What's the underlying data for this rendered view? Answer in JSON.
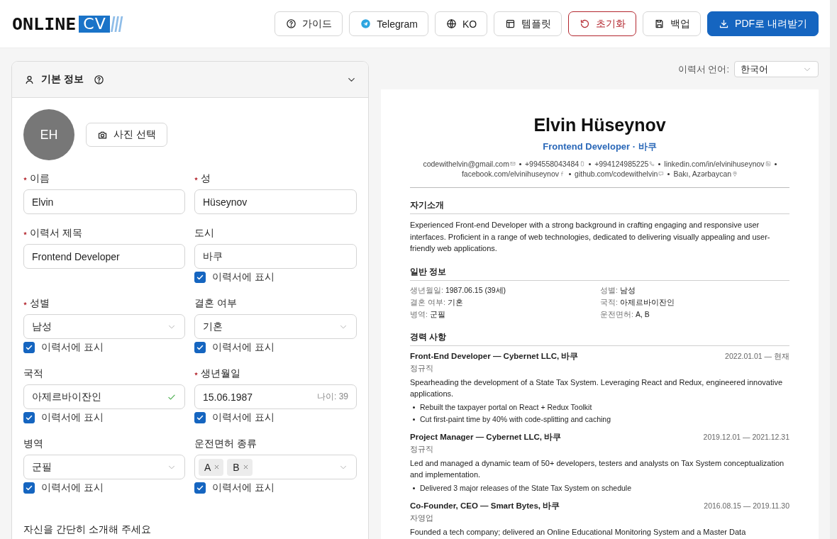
{
  "header": {
    "logo": {
      "text": "ONLINE",
      "highlight": "CV"
    },
    "buttons": [
      {
        "label": "가이드",
        "kind": "default"
      },
      {
        "label": "Telegram",
        "kind": "default"
      },
      {
        "label": "KO",
        "kind": "default"
      },
      {
        "label": "템플릿",
        "kind": "default"
      },
      {
        "label": "초기화",
        "kind": "danger"
      },
      {
        "label": "백업",
        "kind": "default"
      },
      {
        "label": "PDF로 내려받기",
        "kind": "primary"
      }
    ]
  },
  "form": {
    "section": {
      "title": "기본 정보",
      "expanded": true
    },
    "avatar": {
      "initials": "EH"
    },
    "photo_button": "사진 선택",
    "rows": [
      [
        {
          "label": "이름",
          "required": true,
          "kind": "text",
          "value": "Elvin"
        },
        {
          "label": "성",
          "required": true,
          "kind": "text",
          "value": "Hüseynov"
        }
      ],
      [
        {
          "label": "이력서 제목",
          "required": true,
          "kind": "text",
          "value": "Frontend Developer"
        },
        {
          "label": "도시",
          "required": false,
          "kind": "text",
          "value": "바쿠",
          "show_on_resume": {
            "label": "이력서에 표시",
            "checked": true
          }
        }
      ],
      [
        {
          "label": "성별",
          "required": true,
          "kind": "select",
          "value": "남성",
          "show_on_resume": {
            "label": "이력서에 표시",
            "checked": true
          }
        },
        {
          "label": "결혼 여부",
          "required": false,
          "kind": "select",
          "value": "기혼",
          "show_on_resume": {
            "label": "이력서에 표시",
            "checked": true
          }
        }
      ],
      [
        {
          "label": "국적",
          "required": false,
          "kind": "text",
          "value": "아제르바이잔인",
          "valid": true,
          "show_on_resume": {
            "label": "이력서에 표시",
            "checked": true
          }
        },
        {
          "label": "생년월일",
          "required": true,
          "kind": "date",
          "value": "15.06.1987",
          "hint": "나이: 39",
          "show_on_resume": {
            "label": "이력서에 표시",
            "checked": true
          }
        }
      ],
      [
        {
          "label": "병역",
          "required": false,
          "kind": "select",
          "value": "군필",
          "show_on_resume": {
            "label": "이력서에 표시",
            "checked": true
          }
        },
        {
          "label": "운전면허 종류",
          "required": false,
          "kind": "tags",
          "tags": [
            "A",
            "B"
          ],
          "show_on_resume": {
            "label": "이력서에 표시",
            "checked": true
          }
        }
      ]
    ],
    "about_label": "자신을 간단히 소개해 주세요"
  },
  "preview": {
    "language": {
      "label": "이력서 언어:",
      "value": "한국어"
    },
    "resume": {
      "name": "Elvin Hüseynov",
      "headline": "Frontend Developer · 바쿠",
      "contacts": [
        "codewithelvin@gmail.com",
        "+994558043484",
        "+994124985225",
        "linkedin.com/in/elvinihuseynov",
        "facebook.com/elvinihuseynov",
        "github.com/codewithelvin",
        "Bakı, Azərbaycan"
      ],
      "sections": [
        {
          "kind": "text",
          "title": "자기소개",
          "body": "Experienced Front-end Developer with a strong background in crafting engaging and responsive user interfaces. Proficient in a range of web technologies, dedicated to delivering visually appealing and user-friendly web applications."
        },
        {
          "kind": "info",
          "title": "일반 정보",
          "items": [
            {
              "label": "생년월일:",
              "value": "1987.06.15 (39세)"
            },
            {
              "label": "성별:",
              "value": "남성"
            },
            {
              "label": "결혼 여부:",
              "value": "기혼"
            },
            {
              "label": "국적:",
              "value": "아제르바이잔인"
            },
            {
              "label": "병역:",
              "value": "군필"
            },
            {
              "label": "운전면허:",
              "value": "A, B"
            }
          ]
        },
        {
          "kind": "experience",
          "title": "경력 사항",
          "entries": [
            {
              "title": "Front-End Developer — Cybernet LLC, 바쿠",
              "dates": "2022.01.01 — 현재",
              "type": "정규직",
              "description": "Spearheading the development of a State Tax System. Leveraging React and Redux, engineered innovative applications.",
              "bullets": [
                "Rebuilt the taxpayer portal on React + Redux Toolkit",
                "Cut first-paint time by 40% with code-splitting and caching"
              ]
            },
            {
              "title": "Project Manager — Cybernet LLC, 바쿠",
              "dates": "2019.12.01 — 2021.12.31",
              "type": "정규직",
              "description": "Led and managed a dynamic team of 50+ developers, testers and analysts on Tax System conceptualization and implementation.",
              "bullets": [
                "Delivered 3 major releases of the State Tax System on schedule"
              ]
            },
            {
              "title": "Co-Founder, CEO — Smart Bytes, 바쿠",
              "dates": "2016.08.15 — 2019.11.30",
              "type": "자영업",
              "description": "Founded a tech company; delivered an Online Educational Monitoring System and a Master Data"
            }
          ]
        }
      ]
    }
  }
}
